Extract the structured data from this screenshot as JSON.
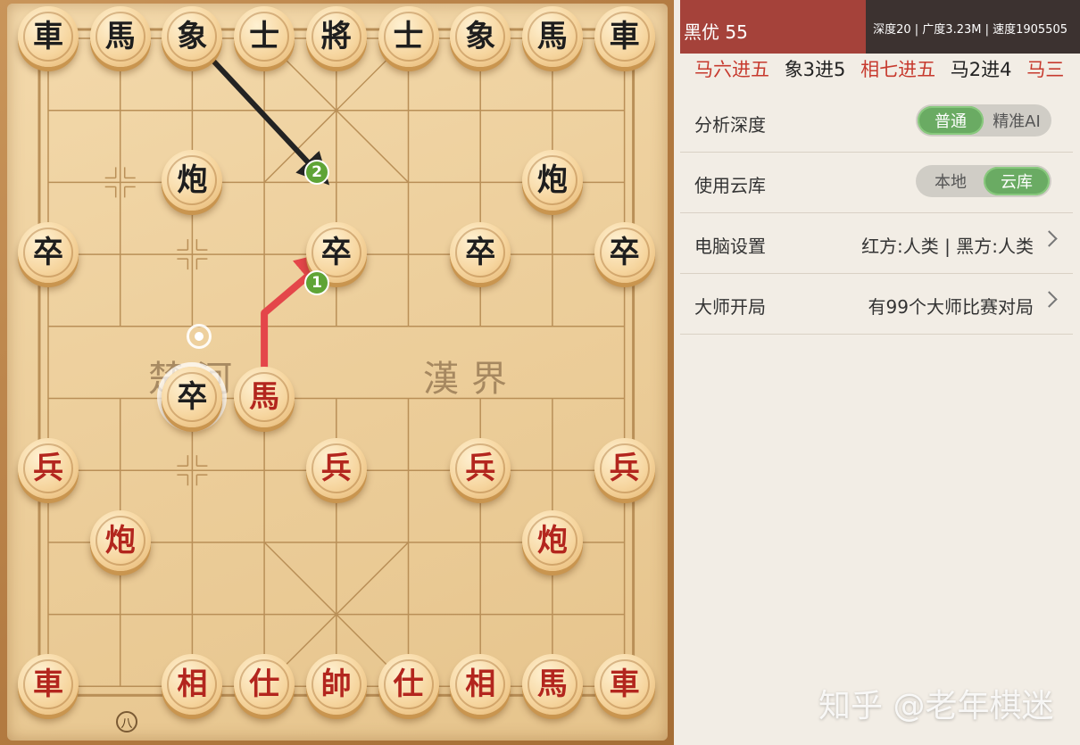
{
  "board": {
    "river_left": "楚河",
    "river_right": "漢界",
    "file_label": "八",
    "arrows": [
      {
        "badge": "1",
        "color": "#e4464a"
      },
      {
        "badge": "2",
        "color": "#232323"
      }
    ],
    "pieces": [
      {
        "char": "車",
        "side": "black",
        "col": 0,
        "row": 0
      },
      {
        "char": "馬",
        "side": "black",
        "col": 1,
        "row": 0
      },
      {
        "char": "象",
        "side": "black",
        "col": 2,
        "row": 0
      },
      {
        "char": "士",
        "side": "black",
        "col": 3,
        "row": 0
      },
      {
        "char": "將",
        "side": "black",
        "col": 4,
        "row": 0
      },
      {
        "char": "士",
        "side": "black",
        "col": 5,
        "row": 0
      },
      {
        "char": "象",
        "side": "black",
        "col": 6,
        "row": 0
      },
      {
        "char": "馬",
        "side": "black",
        "col": 7,
        "row": 0
      },
      {
        "char": "車",
        "side": "black",
        "col": 8,
        "row": 0
      },
      {
        "char": "炮",
        "side": "black",
        "col": 2,
        "row": 2
      },
      {
        "char": "炮",
        "side": "black",
        "col": 7,
        "row": 2
      },
      {
        "char": "卒",
        "side": "black",
        "col": 0,
        "row": 3
      },
      {
        "char": "卒",
        "side": "black",
        "col": 4,
        "row": 3
      },
      {
        "char": "卒",
        "side": "black",
        "col": 6,
        "row": 3
      },
      {
        "char": "卒",
        "side": "black",
        "col": 8,
        "row": 3
      },
      {
        "char": "卒",
        "side": "black",
        "col": 2,
        "row": 5,
        "selected": true
      },
      {
        "char": "馬",
        "side": "red",
        "col": 3,
        "row": 5
      },
      {
        "char": "兵",
        "side": "red",
        "col": 0,
        "row": 6
      },
      {
        "char": "兵",
        "side": "red",
        "col": 4,
        "row": 6
      },
      {
        "char": "兵",
        "side": "red",
        "col": 6,
        "row": 6
      },
      {
        "char": "兵",
        "side": "red",
        "col": 8,
        "row": 6
      },
      {
        "char": "炮",
        "side": "red",
        "col": 1,
        "row": 7
      },
      {
        "char": "炮",
        "side": "red",
        "col": 7,
        "row": 7
      },
      {
        "char": "車",
        "side": "red",
        "col": 0,
        "row": 9
      },
      {
        "char": "相",
        "side": "red",
        "col": 2,
        "row": 9
      },
      {
        "char": "仕",
        "side": "red",
        "col": 3,
        "row": 9
      },
      {
        "char": "帥",
        "side": "red",
        "col": 4,
        "row": 9
      },
      {
        "char": "仕",
        "side": "red",
        "col": 5,
        "row": 9
      },
      {
        "char": "相",
        "side": "red",
        "col": 6,
        "row": 9
      },
      {
        "char": "馬",
        "side": "red",
        "col": 7,
        "row": 9
      },
      {
        "char": "車",
        "side": "red",
        "col": 8,
        "row": 9
      }
    ]
  },
  "panel": {
    "eval_label": "黑优 55",
    "engine_stats": "深度20 | 广度3.23M | 速度1905505",
    "pv_moves": [
      {
        "text": "马六进五",
        "side": "red"
      },
      {
        "text": "象3进5",
        "side": "black"
      },
      {
        "text": "相七进五",
        "side": "red"
      },
      {
        "text": "马2进4",
        "side": "black"
      },
      {
        "text": "马三",
        "side": "red"
      }
    ],
    "analysis_depth": {
      "label": "分析深度",
      "options": [
        "普通",
        "精准AI"
      ],
      "selected": 0
    },
    "cloud_library": {
      "label": "使用云库",
      "options": [
        "本地",
        "云库"
      ],
      "selected": 1
    },
    "computer_settings": {
      "label": "电脑设置",
      "value": "红方:人类 | 黑方:人类"
    },
    "master_openings": {
      "label": "大师开局",
      "value": "有99个大师比赛对局"
    },
    "watermark": "知乎 @老年棋迷"
  }
}
